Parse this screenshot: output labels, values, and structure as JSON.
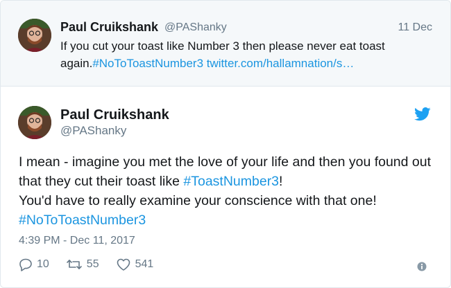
{
  "parent_tweet": {
    "author_name": "Paul Cruikshank",
    "author_handle": "@PAShanky",
    "date": "11 Dec",
    "text": "If you cut your toast like Number 3 then please never eat toast again.",
    "hashtag": "#NoToToastNumber3",
    "link": "twitter.com/hallamnation/s…"
  },
  "main_tweet": {
    "author_name": "Paul Cruikshank",
    "author_handle": "@PAShanky",
    "text_line1_part1": "I mean - imagine you met the love of your life and then you found out that they cut their toast like ",
    "text_line1_hashtag": "#ToastNumber3",
    "text_line1_end": "!",
    "text_line2": "You'd have to really examine your conscience with that one!",
    "text_hashtag2": "#NoToToastNumber3",
    "timestamp": "4:39 PM - Dec 11, 2017"
  },
  "actions": {
    "replies": "10",
    "retweets": "55",
    "likes": "541"
  },
  "colors": {
    "link": "#1b95e0",
    "muted": "#657786",
    "twitter_blue": "#1da1f2"
  },
  "icons": [
    "twitter-bird-icon",
    "reply-icon",
    "retweet-icon",
    "like-icon",
    "info-icon"
  ]
}
